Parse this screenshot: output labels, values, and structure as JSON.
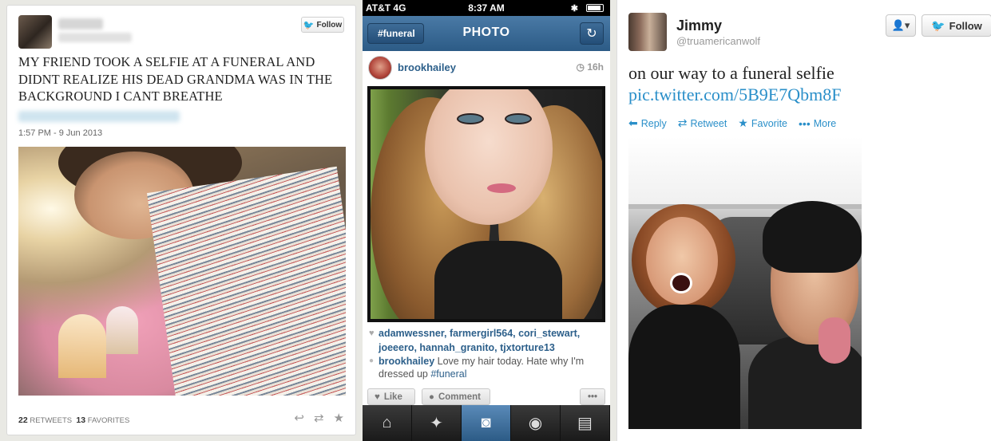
{
  "panel1": {
    "follow_label": "Follow",
    "tweet_text": "MY FRIEND TOOK A SELFIE AT A FUNERAL AND DIDNT REALIZE HIS DEAD GRANDMA WAS IN THE BACKGROUND I CANT BREATHE",
    "timestamp": "1:57 PM - 9 Jun 2013",
    "retweets_count": "22",
    "retweets_label": "RETWEETS",
    "favorites_count": "13",
    "favorites_label": "FAVORITES",
    "icons": [
      "twitter-bird-icon",
      "reply-icon",
      "retweet-icon",
      "favorite-star-icon"
    ]
  },
  "panel2": {
    "status_bar": {
      "carrier": "AT&T 4G",
      "time": "8:37 AM"
    },
    "nav": {
      "back_label": "#funeral",
      "title": "PHOTO"
    },
    "post": {
      "username": "brookhailey",
      "age": "16h",
      "likes": "adamwessner, farmergirl564, cori_stewart, joeeero, hannah_granito, tjxtorture13",
      "caption_user": "brookhailey",
      "caption_text": "Love my hair today. Hate why I'm dressed up",
      "caption_tag": "#funeral"
    },
    "buttons": {
      "like": "Like",
      "comment": "Comment",
      "more": "•••"
    },
    "tabs": [
      "home-icon",
      "explore-icon",
      "camera-icon",
      "news-icon",
      "profile-icon"
    ]
  },
  "panel3": {
    "name": "Jimmy",
    "handle": "@truamericanwolf",
    "follow_label": "Follow",
    "user_menu_label": "▾",
    "tweet_text": "on our way to a funeral selfie",
    "tweet_link": "pic.twitter.com/5B9E7Qbm8F",
    "actions": {
      "reply": "Reply",
      "retweet": "Retweet",
      "favorite": "Favorite",
      "more": "More"
    }
  },
  "colors": {
    "twitter_blue": "#2a8fc9",
    "instagram_nav": "#2c5b86",
    "link_blue": "#2c5f8a"
  }
}
